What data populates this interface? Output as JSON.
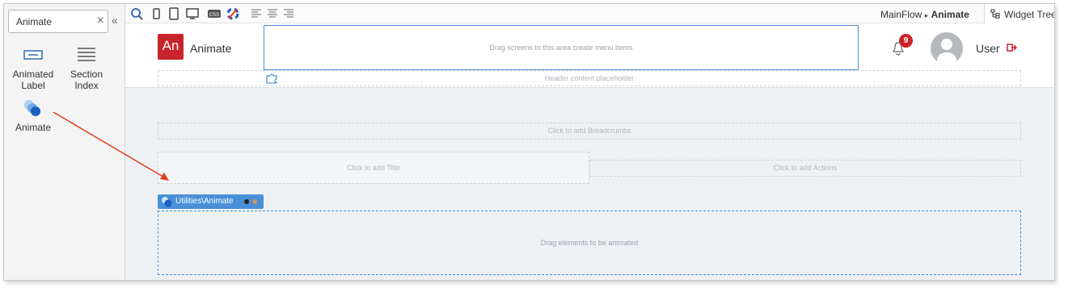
{
  "search": {
    "value": "Animate",
    "clear_symbol": "×",
    "collapse_symbol": "«"
  },
  "widgets": [
    {
      "label_line1": "Animated",
      "label_line2": "Label",
      "icon": "label-widget-icon"
    },
    {
      "label_line1": "Section",
      "label_line2": "Index",
      "icon": "section-index-icon"
    },
    {
      "label_line1": "Animate",
      "label_line2": "",
      "icon": "animate-widget-icon"
    }
  ],
  "toolbar": {
    "breadcrumb_flow": "MainFlow",
    "breadcrumb_separator": "▸",
    "breadcrumb_screen": "Animate",
    "widget_tree_tab": "Widget Tree",
    "icons": [
      "preview-icon",
      "phone-icon",
      "tablet-icon",
      "desktop-icon",
      "css-icon",
      "theme-icon",
      "align-left-icon",
      "align-center-icon",
      "align-right-icon"
    ]
  },
  "header": {
    "logo_text": "An",
    "app_name": "Animate",
    "menu_placeholder": "Drag screens to this area create menu items",
    "content_placeholder": "Header content placeholder",
    "notification_count": "9",
    "user_name": "User"
  },
  "main": {
    "breadcrumbs_placeholder": "Click to add Breadcrumbs",
    "title_placeholder": "Click to add Title",
    "actions_placeholder": "Click to add Actions",
    "animate_tag": "Utilities\\Animate",
    "animate_placeholder": "Drag elements to be animated"
  },
  "colors": {
    "accent": "#4a90d9",
    "brand": "#c8242c",
    "arrow": "#e03c1e"
  }
}
